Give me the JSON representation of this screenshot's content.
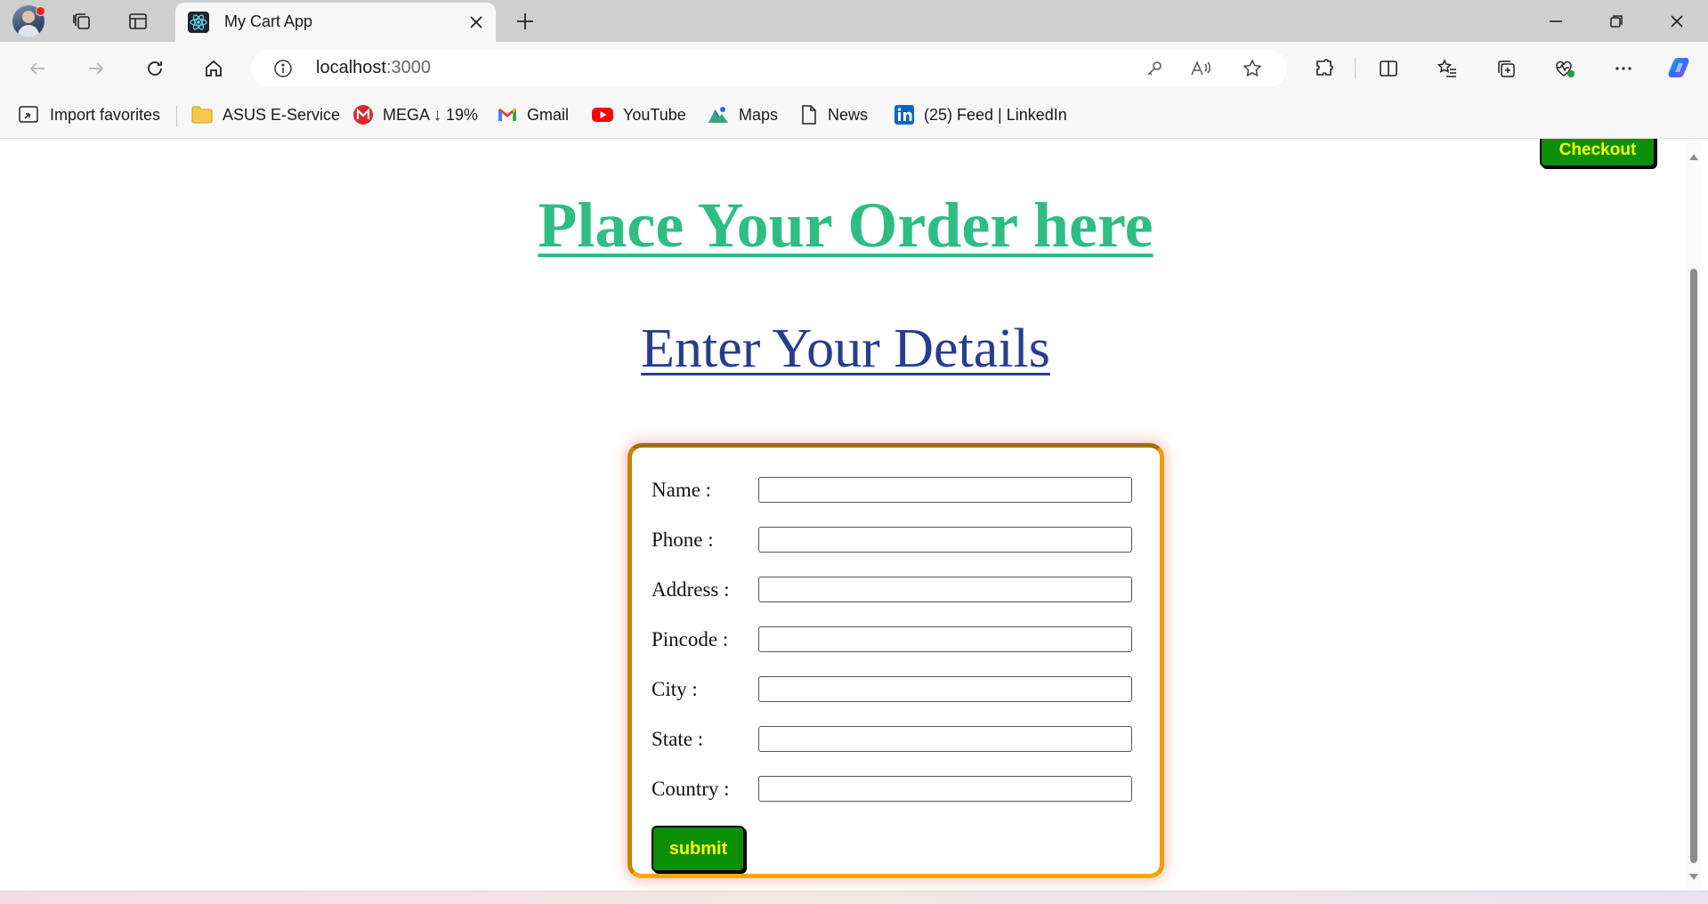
{
  "browser": {
    "tab_title": "My Cart App",
    "url_host": "localhost",
    "url_port": ":3000",
    "bookmarks": [
      {
        "label": "Import favorites",
        "icon": "import-icon"
      },
      {
        "label": "ASUS E-Service",
        "icon": "folder-icon"
      },
      {
        "label": "MEGA ↓ 19%",
        "icon": "mega-icon"
      },
      {
        "label": "Gmail",
        "icon": "gmail-icon"
      },
      {
        "label": "YouTube",
        "icon": "youtube-icon"
      },
      {
        "label": "Maps",
        "icon": "maps-icon"
      },
      {
        "label": "News",
        "icon": "news-icon"
      },
      {
        "label": "(25) Feed | LinkedIn",
        "icon": "linkedin-icon"
      }
    ]
  },
  "page": {
    "checkout_label": "Checkout",
    "heading": "Place Your Order here",
    "subheading": "Enter Your Details",
    "form": {
      "fields": [
        {
          "label": "Name :",
          "value": ""
        },
        {
          "label": "Phone :",
          "value": ""
        },
        {
          "label": "Address :",
          "value": ""
        },
        {
          "label": "Pincode :",
          "value": ""
        },
        {
          "label": "City :",
          "value": ""
        },
        {
          "label": "State :",
          "value": ""
        },
        {
          "label": "Country :",
          "value": ""
        }
      ],
      "submit_label": "submit"
    }
  },
  "colors": {
    "heading": "#2ebd82",
    "subheading": "#283c90",
    "button_bg": "#0a8f06",
    "button_text": "#ffff00",
    "form_border": "#f29c00"
  }
}
